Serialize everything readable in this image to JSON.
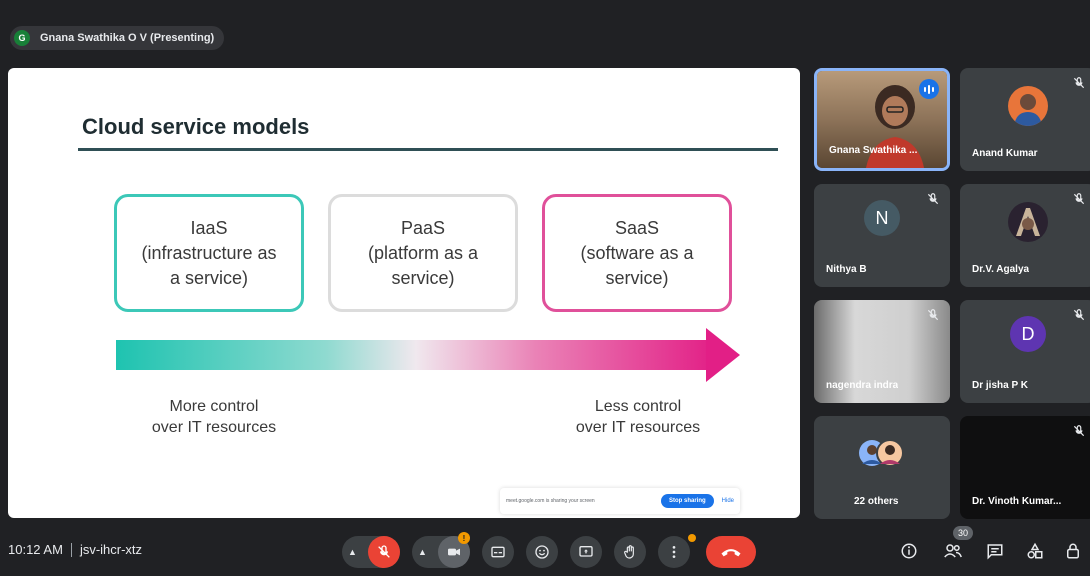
{
  "meeting": {
    "presenter_initial": "G",
    "presenter_label": "Gnana Swathika O V (Presenting)",
    "time": "10:12 AM",
    "code": "jsv-ihcr-xtz",
    "participant_count": "30",
    "reaction_badge": "!"
  },
  "slide": {
    "title": "Cloud service models",
    "models": [
      {
        "lines": [
          "IaaS",
          "(infrastructure as",
          "a service)"
        ],
        "color": "#3cc8b8"
      },
      {
        "lines": [
          "PaaS",
          "(platform as a",
          "service)"
        ],
        "color": "#dcdcdc"
      },
      {
        "lines": [
          "SaaS",
          "(software as a",
          "service)"
        ],
        "color": "#e0509a"
      }
    ],
    "left_label": [
      "More control",
      "over IT resources"
    ],
    "right_label": [
      "Less control",
      "over IT resources"
    ],
    "gradient_colors": [
      "#1ec3b0",
      "#e21f86"
    ]
  },
  "sharing_bar": {
    "text": "meet.google.com is sharing your screen",
    "stop_label": "Stop sharing",
    "hide_label": "Hide"
  },
  "participants": [
    {
      "name": "Gnana Swathika ...",
      "type": "video",
      "presenting": true
    },
    {
      "name": "Anand Kumar",
      "type": "photo",
      "muted": true
    },
    {
      "name": "Nithya B",
      "type": "letter",
      "letter": "N",
      "color": "#455a64",
      "muted": true
    },
    {
      "name": "Dr.V. Agalya",
      "type": "photo",
      "muted": true
    },
    {
      "name": "nagendra indra",
      "type": "video",
      "muted": true
    },
    {
      "name": "Dr jisha P K",
      "type": "letter",
      "letter": "D",
      "color": "#5e35b1",
      "muted": true
    },
    {
      "name": "22 others",
      "type": "group"
    },
    {
      "name": "Dr. Vinoth Kumar...",
      "type": "dark",
      "muted": true
    }
  ],
  "colors": {
    "background": "#202124",
    "tile": "#3c4043",
    "hangup": "#ea4335",
    "accent": "#1a73e8"
  }
}
